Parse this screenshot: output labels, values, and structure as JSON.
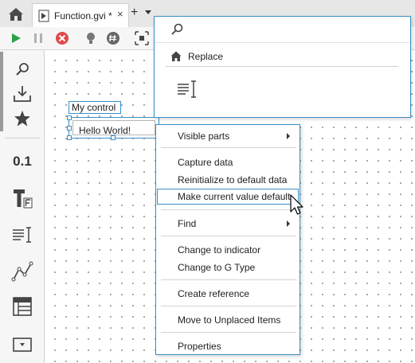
{
  "tabs": {
    "home_icon": "home-icon",
    "document": {
      "title": "Function.gvi *",
      "close": "×"
    },
    "add": "+"
  },
  "toolbar": {
    "icons": [
      "run-icon",
      "pause-icon",
      "abort-icon",
      "highlight-icon",
      "hash-icon",
      "layout-icon"
    ]
  },
  "palette": {
    "numeric_label": "0.1",
    "icons": [
      "search-icon",
      "download-icon",
      "star-icon",
      "numeric-icon",
      "boolean-icon",
      "string-icon",
      "graph-icon",
      "array-icon",
      "dropdown-icon"
    ]
  },
  "canvas": {
    "label": "My control",
    "control_value": "Hello World!"
  },
  "search_popup": {
    "search_value": "",
    "replace_label": "Replace"
  },
  "context_menu": {
    "items": {
      "visible_parts": "Visible parts",
      "capture_data": "Capture data",
      "reinitialize": "Reinitialize to default data",
      "make_default": "Make current value default",
      "find": "Find",
      "change_indicator": "Change to indicator",
      "change_gtype": "Change to G Type",
      "create_reference": "Create reference",
      "move_unplaced": "Move to Unplaced Items",
      "properties": "Properties"
    }
  },
  "colors": {
    "accent": "#3a8fc7",
    "run_green": "#2aa048",
    "abort_red": "#e04a4a"
  }
}
